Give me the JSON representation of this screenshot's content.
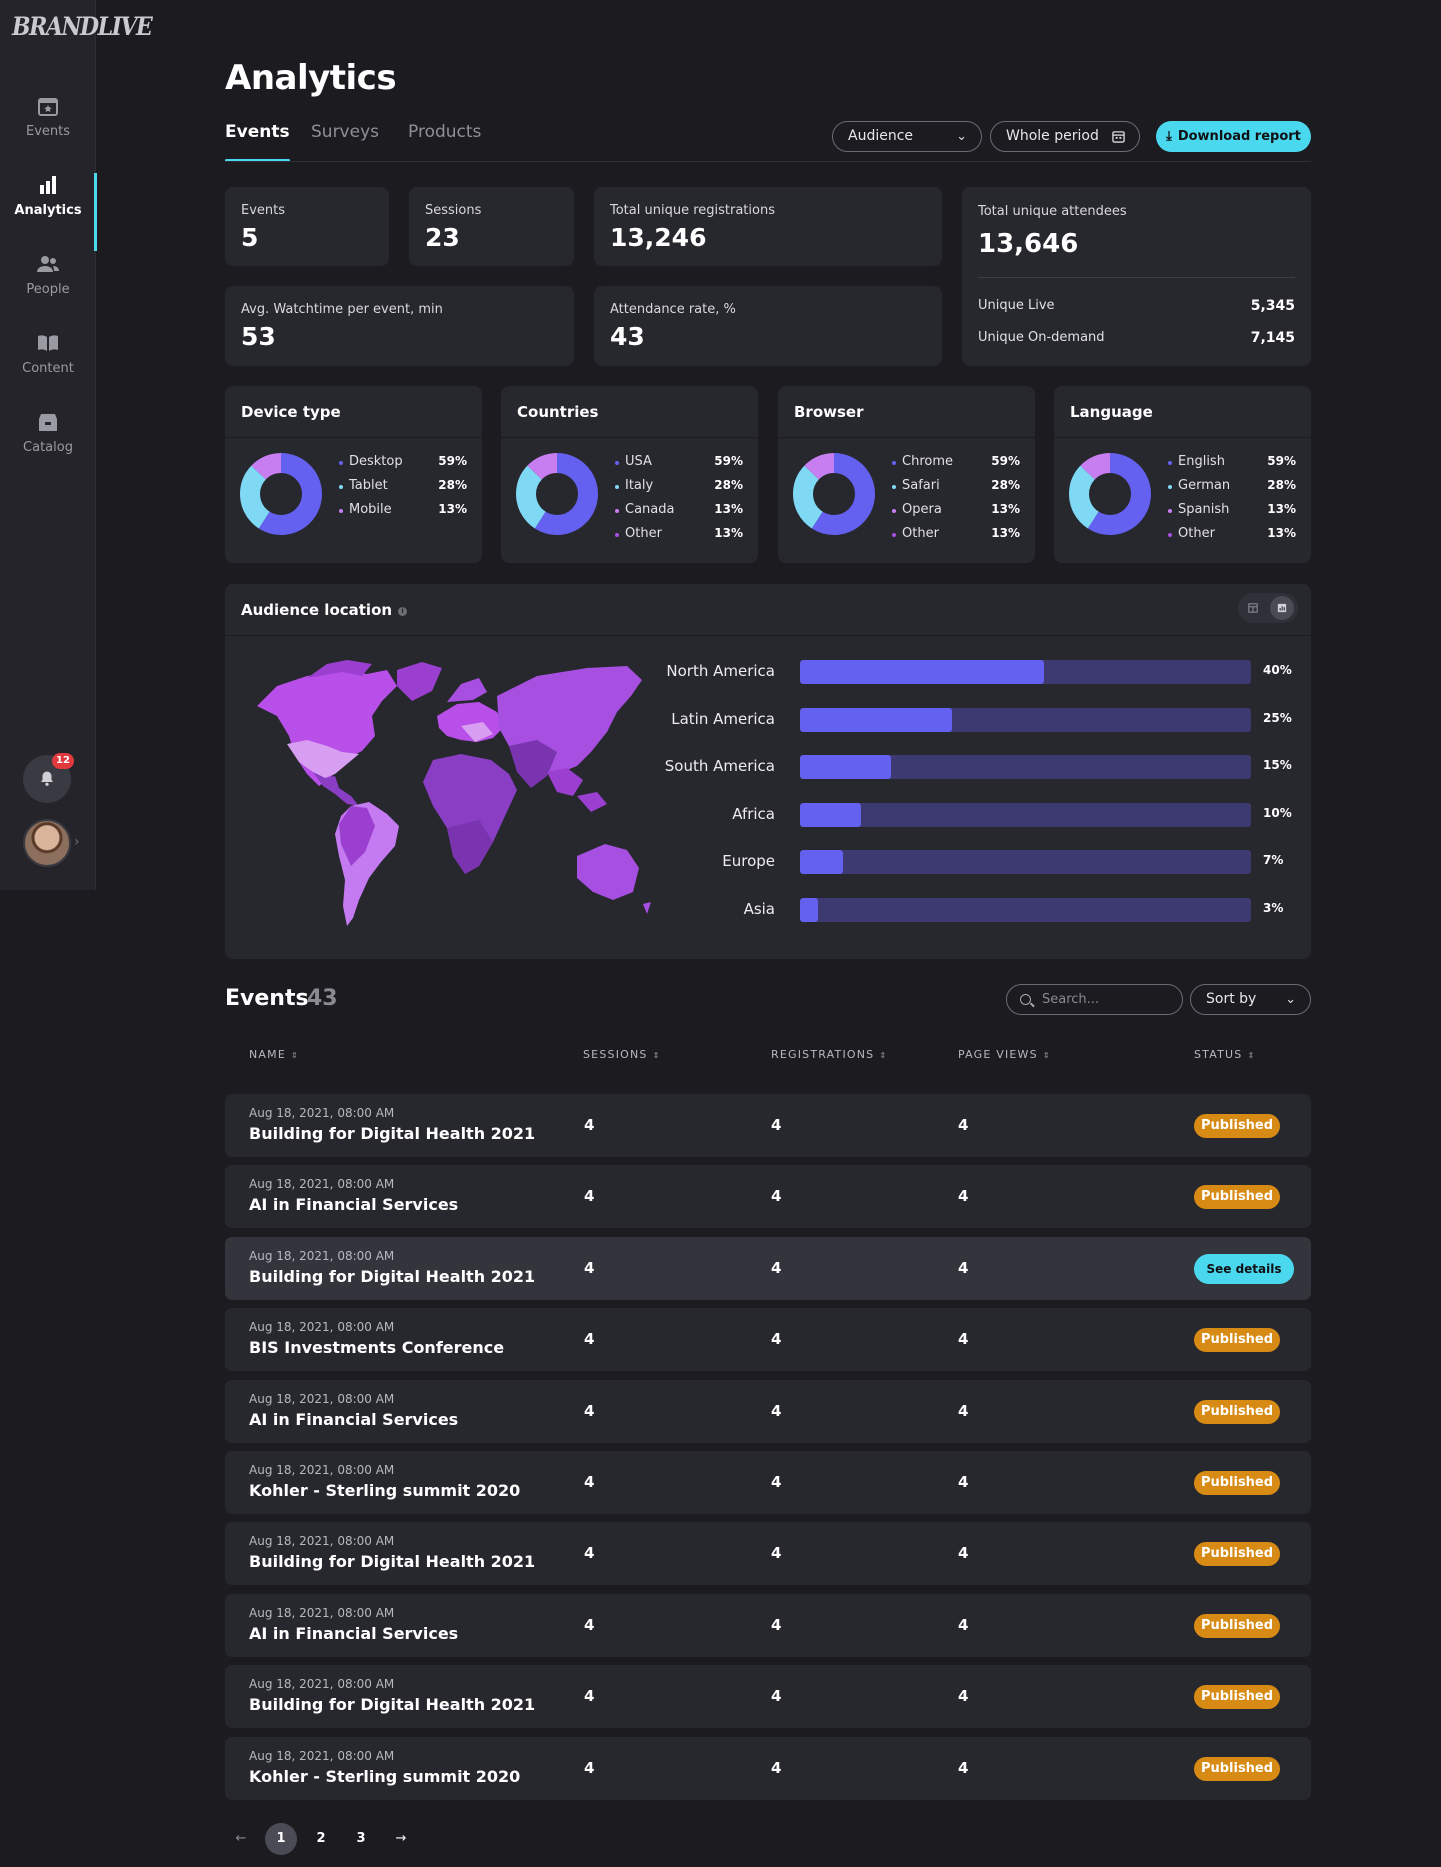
{
  "brand": "BRANDLIVE",
  "sidebar": {
    "items": [
      {
        "label": "Events",
        "icon": "calendar-star-icon"
      },
      {
        "label": "Analytics",
        "icon": "bar-chart-icon"
      },
      {
        "label": "People",
        "icon": "people-icon"
      },
      {
        "label": "Content",
        "icon": "book-icon"
      },
      {
        "label": "Catalog",
        "icon": "catalog-icon"
      }
    ],
    "notifications": "12"
  },
  "page": {
    "title": "Analytics"
  },
  "tabs": [
    "Events",
    "Surveys",
    "Products"
  ],
  "filters": {
    "audience": "Audience",
    "period": "Whole period",
    "download": "Download report"
  },
  "stats": {
    "events": {
      "label": "Events",
      "value": "5"
    },
    "sessions": {
      "label": "Sessions",
      "value": "23"
    },
    "registrations": {
      "label": "Total unique registrations",
      "value": "13,246"
    },
    "watchtime": {
      "label": "Avg. Watchtime per event, min",
      "value": "53"
    },
    "attendance": {
      "label": "Attendance rate, %",
      "value": "43"
    },
    "attendees": {
      "label": "Total unique attendees",
      "value": "13,646",
      "live_label": "Unique Live",
      "live_value": "5,345",
      "ondemand_label": "Unique On-demand",
      "ondemand_value": "7,145"
    }
  },
  "donut_colors": [
    "#6460f0",
    "#7fd9f5",
    "#c77ef0",
    "#a64fe0"
  ],
  "breakdowns": [
    {
      "title": "Device type",
      "items": [
        {
          "label": "Desktop",
          "pct": "59%",
          "value": 59
        },
        {
          "label": "Tablet",
          "pct": "28%",
          "value": 28
        },
        {
          "label": "Mobile",
          "pct": "13%",
          "value": 13
        }
      ]
    },
    {
      "title": "Countries",
      "items": [
        {
          "label": "USA",
          "pct": "59%",
          "value": 59
        },
        {
          "label": "Italy",
          "pct": "28%",
          "value": 28
        },
        {
          "label": "Canada",
          "pct": "13%",
          "value": 13
        },
        {
          "label": "Other",
          "pct": "13%",
          "value": 13
        }
      ]
    },
    {
      "title": "Browser",
      "items": [
        {
          "label": "Chrome",
          "pct": "59%",
          "value": 59
        },
        {
          "label": "Safari",
          "pct": "28%",
          "value": 28
        },
        {
          "label": "Opera",
          "pct": "13%",
          "value": 13
        },
        {
          "label": "Other",
          "pct": "13%",
          "value": 13
        }
      ]
    },
    {
      "title": "Language",
      "items": [
        {
          "label": "English",
          "pct": "59%",
          "value": 59
        },
        {
          "label": "German",
          "pct": "28%",
          "value": 28
        },
        {
          "label": "Spanish",
          "pct": "13%",
          "value": 13
        },
        {
          "label": "Other",
          "pct": "13%",
          "value": 13
        }
      ]
    }
  ],
  "audience_location": {
    "title": "Audience location",
    "regions": [
      {
        "name": "North America",
        "pct": "40%",
        "value": 40
      },
      {
        "name": "Latin America",
        "pct": "25%",
        "value": 25
      },
      {
        "name": "South America",
        "pct": "15%",
        "value": 15
      },
      {
        "name": "Africa",
        "pct": "10%",
        "value": 10
      },
      {
        "name": "Europe",
        "pct": "7%",
        "value": 7
      },
      {
        "name": "Asia",
        "pct": "3%",
        "value": 3
      }
    ]
  },
  "events_table": {
    "title": "Events",
    "count": "43",
    "search_placeholder": "Search...",
    "sort_label": "Sort by",
    "columns": [
      "NAME",
      "SESSIONS",
      "REGISTRATIONS",
      "PAGE VIEWS",
      "STATUS"
    ],
    "rows": [
      {
        "date": "Aug 18, 2021, 08:00 AM",
        "name": "Building for Digital Health 2021",
        "sessions": "4",
        "registrations": "4",
        "page_views": "4",
        "status": "Published"
      },
      {
        "date": "Aug 18, 2021, 08:00 AM",
        "name": "AI in Financial Services",
        "sessions": "4",
        "registrations": "4",
        "page_views": "4",
        "status": "Published"
      },
      {
        "date": "Aug 18, 2021, 08:00 AM",
        "name": "Building for Digital Health 2021",
        "sessions": "4",
        "registrations": "4",
        "page_views": "4",
        "status": "See details"
      },
      {
        "date": "Aug 18, 2021, 08:00 AM",
        "name": "BIS Investments Conference",
        "sessions": "4",
        "registrations": "4",
        "page_views": "4",
        "status": "Published"
      },
      {
        "date": "Aug 18, 2021, 08:00 AM",
        "name": "AI in Financial Services",
        "sessions": "4",
        "registrations": "4",
        "page_views": "4",
        "status": "Published"
      },
      {
        "date": "Aug 18, 2021, 08:00 AM",
        "name": "Kohler - Sterling summit 2020",
        "sessions": "4",
        "registrations": "4",
        "page_views": "4",
        "status": "Published"
      },
      {
        "date": "Aug 18, 2021, 08:00 AM",
        "name": "Building for Digital Health 2021",
        "sessions": "4",
        "registrations": "4",
        "page_views": "4",
        "status": "Published"
      },
      {
        "date": "Aug 18, 2021, 08:00 AM",
        "name": "AI in Financial Services",
        "sessions": "4",
        "registrations": "4",
        "page_views": "4",
        "status": "Published"
      },
      {
        "date": "Aug 18, 2021, 08:00 AM",
        "name": "Building for Digital Health 2021",
        "sessions": "4",
        "registrations": "4",
        "page_views": "4",
        "status": "Published"
      },
      {
        "date": "Aug 18, 2021, 08:00 AM",
        "name": "Kohler - Sterling summit 2020",
        "sessions": "4",
        "registrations": "4",
        "page_views": "4",
        "status": "Published"
      }
    ]
  },
  "pagination": {
    "prev": "←",
    "pages": [
      "1",
      "2",
      "3"
    ],
    "next": "→",
    "current": "1"
  }
}
